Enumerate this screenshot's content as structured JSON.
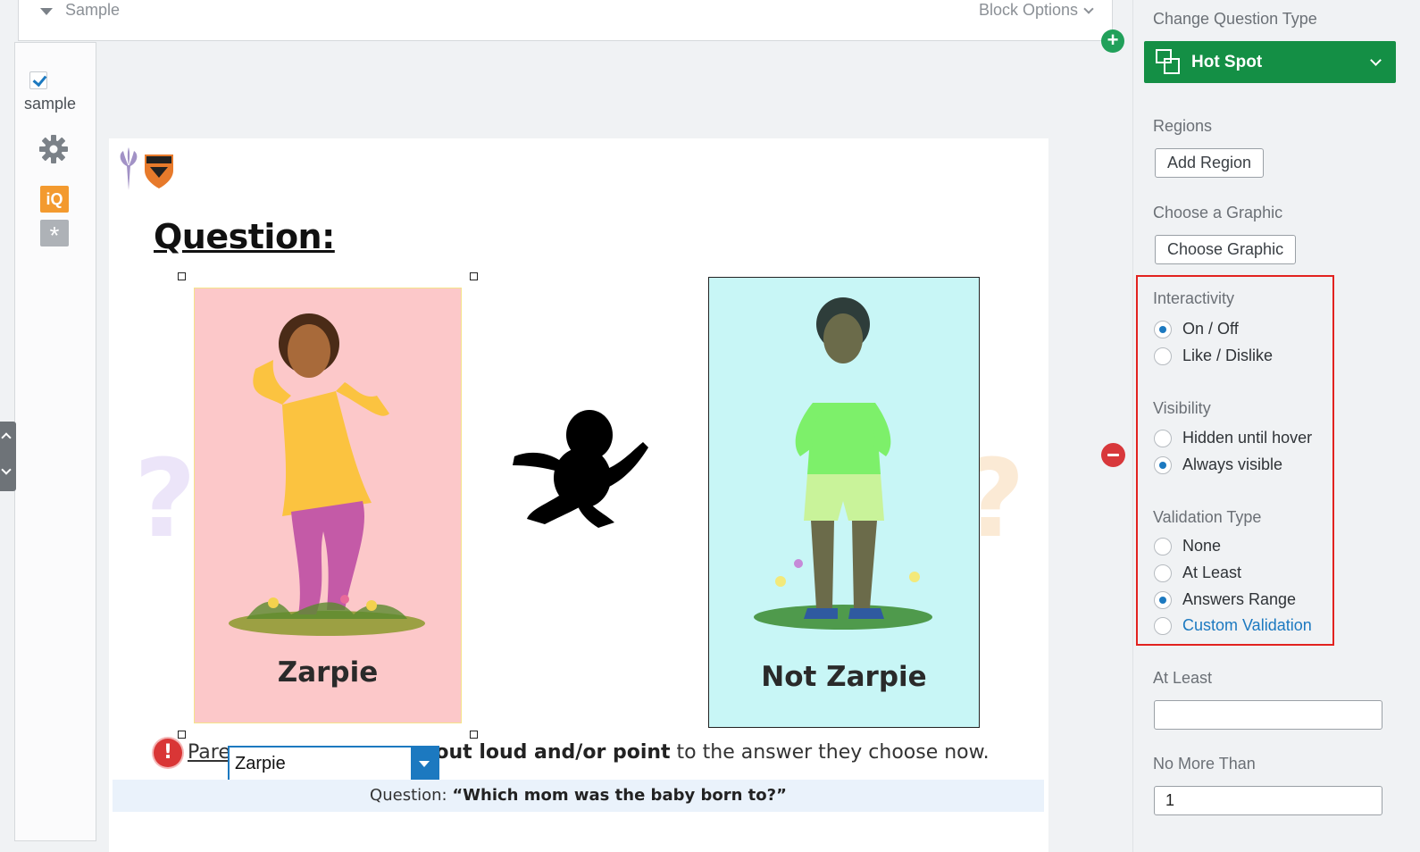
{
  "block": {
    "name": "Sample",
    "options_label": "Block Options"
  },
  "question": {
    "id_label": "sample",
    "badge_iq": "iQ",
    "badge_star": "*",
    "heading": "Question:",
    "left_card_label": "Zarpie",
    "right_card_label": "Not Zarpie",
    "instruction_pre": "Pare",
    "instruction_bold": "nswer out loud and/or point",
    "instruction_post": " to the answer they choose now.",
    "dropdown_value": "Zarpie",
    "caption_prefix": "Question: ",
    "caption_bold": "“Which mom was the baby born to?”"
  },
  "panel": {
    "change_type_label": "Change Question Type",
    "type_value": "Hot Spot",
    "regions_label": "Regions",
    "add_region": "Add Region",
    "choose_graphic_label": "Choose a Graphic",
    "choose_graphic_btn": "Choose Graphic",
    "interactivity_label": "Interactivity",
    "interactivity_options": [
      "On / Off",
      "Like / Dislike"
    ],
    "visibility_label": "Visibility",
    "visibility_options": [
      "Hidden until hover",
      "Always visible"
    ],
    "validation_label": "Validation Type",
    "validation_options": [
      "None",
      "At Least",
      "Answers Range",
      "Custom Validation"
    ],
    "at_least_label": "At Least",
    "at_least_value": "",
    "no_more_than_label": "No More Than",
    "no_more_than_value": "1"
  },
  "colors": {
    "accent_green": "#148f45",
    "accent_blue": "#1c79c0",
    "highlight_red": "#e2221f"
  }
}
